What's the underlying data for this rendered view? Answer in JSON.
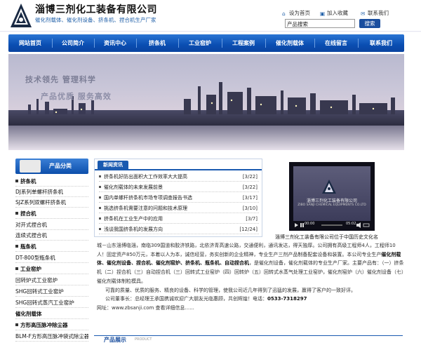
{
  "header": {
    "company_name": "淄博三剂化工装备有限公司",
    "slogan": "催化剂载体、催化剂设备、挤条机、捏合机生产厂家",
    "links": [
      "设为首页",
      "加入收藏",
      "联系我们"
    ],
    "search_value": "产品搜索",
    "search_button": "搜索"
  },
  "nav": [
    "网站首页",
    "公司简介",
    "资讯中心",
    "挤条机",
    "工业窑炉",
    "工程案例",
    "催化剂载体",
    "在线留言",
    "联系我们"
  ],
  "banner": {
    "line1": "技术领先  管理科学",
    "line2": "产品优质  服务高效"
  },
  "sidebar": {
    "title": "产品分类",
    "items": [
      {
        "label": "挤条机",
        "cat": true
      },
      {
        "label": "DJ系列单螺杆挤条机",
        "cat": false
      },
      {
        "label": "SJZ系列双螺杆挤条机",
        "cat": false
      },
      {
        "label": "捏合机",
        "cat": true
      },
      {
        "label": "对开式捏合机",
        "cat": false
      },
      {
        "label": "连续式捏合机",
        "cat": false
      },
      {
        "label": "瓶条机",
        "cat": true
      },
      {
        "label": "DT-800型瓶条机",
        "cat": false
      },
      {
        "label": "工业窑炉",
        "cat": true
      },
      {
        "label": "回转炉式工业窑炉",
        "cat": false
      },
      {
        "label": "SHG回转式工业窑炉",
        "cat": false
      },
      {
        "label": "SHG回转式蒸汽工业窑炉",
        "cat": false
      },
      {
        "label": "催化剂载体",
        "cat": true
      },
      {
        "label": "方形高压脉冲除尘器",
        "cat": true
      },
      {
        "label": "BLM-F方形高压脉冲袋式除尘器",
        "cat": false
      }
    ]
  },
  "news": {
    "tab": "新闻资讯",
    "items": [
      {
        "title": "挤条机好防出面积大工作效率大大提高",
        "date": "[3/22]"
      },
      {
        "title": "催化剂载体的未来发展前景",
        "date": "[3/22]"
      },
      {
        "title": "国内单螺杆挤条机市场专项调查报告书选",
        "date": "[3/17]"
      },
      {
        "title": "挑选挤条机需要注意的问题和技术原理",
        "date": "[3/10]"
      },
      {
        "title": "挤条机在工业生产中的应用",
        "date": "[3/7]"
      },
      {
        "title": "浅谈我国挤条机的发展方向",
        "date": "[12/24]"
      }
    ]
  },
  "video": {
    "company": "淄博三剂化工装备有限公司",
    "company_en": "ZIBO SANJI CHEMICAL EQUIPMENTS CO.LTD",
    "time_current": "00:00",
    "time_total": "05:02",
    "caption": "淄博三剂化工装备有限公司位于中国历史文化名"
  },
  "intro": {
    "p1_a": "城－山东淄博临淄，南临309国道和胶济铁路，北依济青高速公路，交通便利，通讯发达，得天独厚。公司拥有高级工程师4人，工程师10人！固定资产850万元，本着以人为本，诚信经营，务实创新的企业精神，专业生产三剂产品制备配套设备和装置。本公司专业生产",
    "p1_b": "催化剂载体、催化剂设备、捏合机、催化剂窑炉、挤条机、瓶条机、自动捏合机",
    "p1_c": "，是催化剂设备，催化剂载体的专业生产厂家。主要产品有：（一）挤条机（二）捏合机（三）自动捏合机（三）回转式工业窑炉（四）回转炉（五）回转式水蒸气处理工业窑炉，催化剂窑炉（六）催化剂设备（七）催化剂载体制粒模具。",
    "p2": "可靠的质量、优质的服务、精良的设备、科学的管理，使我公司近几年得到了迅猛的发展，赢得了客户的一致好评。",
    "p3_a": "公司董事长：总经理王承国携诚欢迎广大朋友光临惠顾，共创辉煌！电话：",
    "tel": "0533-7318297",
    "p4": "网址：www.zbsanji.com   查看详细信息......"
  },
  "products": {
    "label": "产品展示",
    "label_en": "PRODUCT"
  }
}
